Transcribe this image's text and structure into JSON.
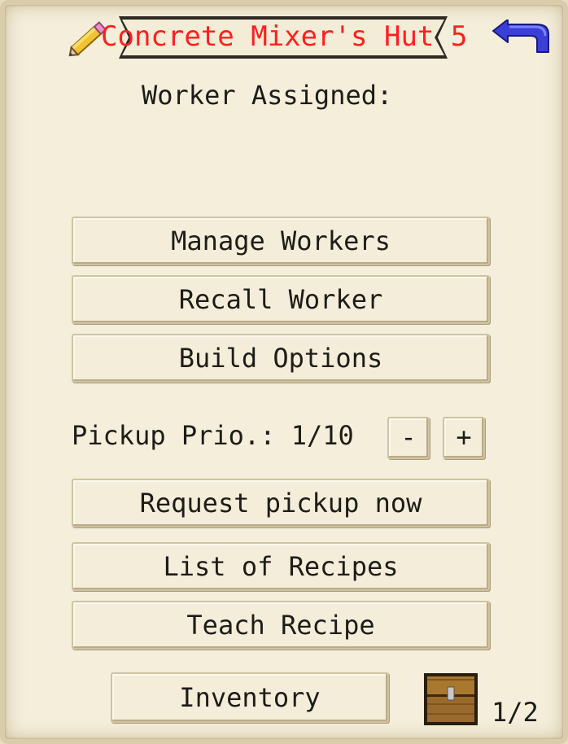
{
  "header": {
    "title": "Concrete Mixer's Hut 5",
    "rename_icon": "pencil-icon",
    "back_icon": "back-arrow-icon"
  },
  "workers": {
    "assigned_label": "Worker Assigned:"
  },
  "buttons": {
    "manage_workers": "Manage Workers",
    "recall_worker": "Recall Worker",
    "build_options": "Build Options",
    "request_pickup": "Request pickup now",
    "list_recipes": "List of Recipes",
    "teach_recipe": "Teach Recipe",
    "inventory": "Inventory"
  },
  "pickup": {
    "label": "Pickup Prio.: 1/10",
    "minus": "-",
    "plus": "+"
  },
  "pagination": {
    "page": "1/2",
    "icon": "chest-icon"
  },
  "colors": {
    "title": "#ff1f1f",
    "text": "#1e1c18",
    "parchment": "#f4eedb",
    "arrow": "#3a3ad8"
  }
}
